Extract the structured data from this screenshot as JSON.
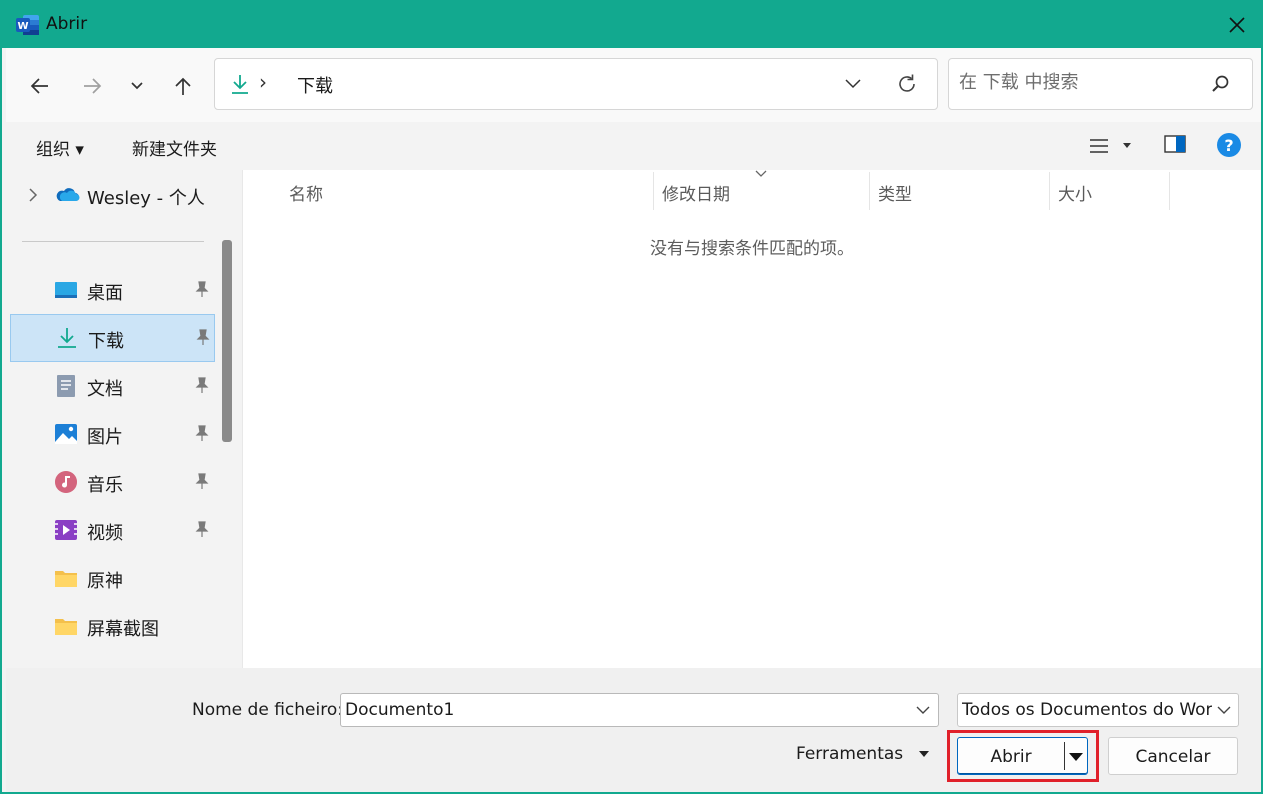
{
  "window": {
    "title": "Abrir",
    "accent": "#12a98f"
  },
  "nav": {
    "back": "arrow-left-icon",
    "forward": "arrow-right-icon",
    "recent": "chevron-down-icon",
    "up": "arrow-up-icon"
  },
  "address": {
    "folder": "下载",
    "separator": "›"
  },
  "search": {
    "placeholder": "在 下载 中搜索"
  },
  "commandbar": {
    "organize": "组织 ▾",
    "new_folder": "新建文件夹"
  },
  "sidebar": {
    "onedrive": "Wesley - 个人",
    "items": [
      {
        "label": "桌面",
        "icon": "desktop-icon"
      },
      {
        "label": "下载",
        "icon": "download-icon",
        "selected": true
      },
      {
        "label": "文档",
        "icon": "document-icon"
      },
      {
        "label": "图片",
        "icon": "pictures-icon"
      },
      {
        "label": "音乐",
        "icon": "music-icon"
      },
      {
        "label": "视频",
        "icon": "video-icon"
      },
      {
        "label": "原神",
        "icon": "folder-icon"
      },
      {
        "label": "屏幕截图",
        "icon": "folder-icon"
      }
    ]
  },
  "columns": {
    "name": "名称",
    "modified": "修改日期",
    "type": "类型",
    "size": "大小"
  },
  "empty_message": "没有与搜索条件匹配的项。",
  "footer": {
    "filename_label": "Nome de ficheiro:",
    "filename_value": "Documento1",
    "filetype_value": "Todos os Documentos do Word",
    "tools": "Ferramentas",
    "open": "Abrir",
    "cancel": "Cancelar"
  }
}
